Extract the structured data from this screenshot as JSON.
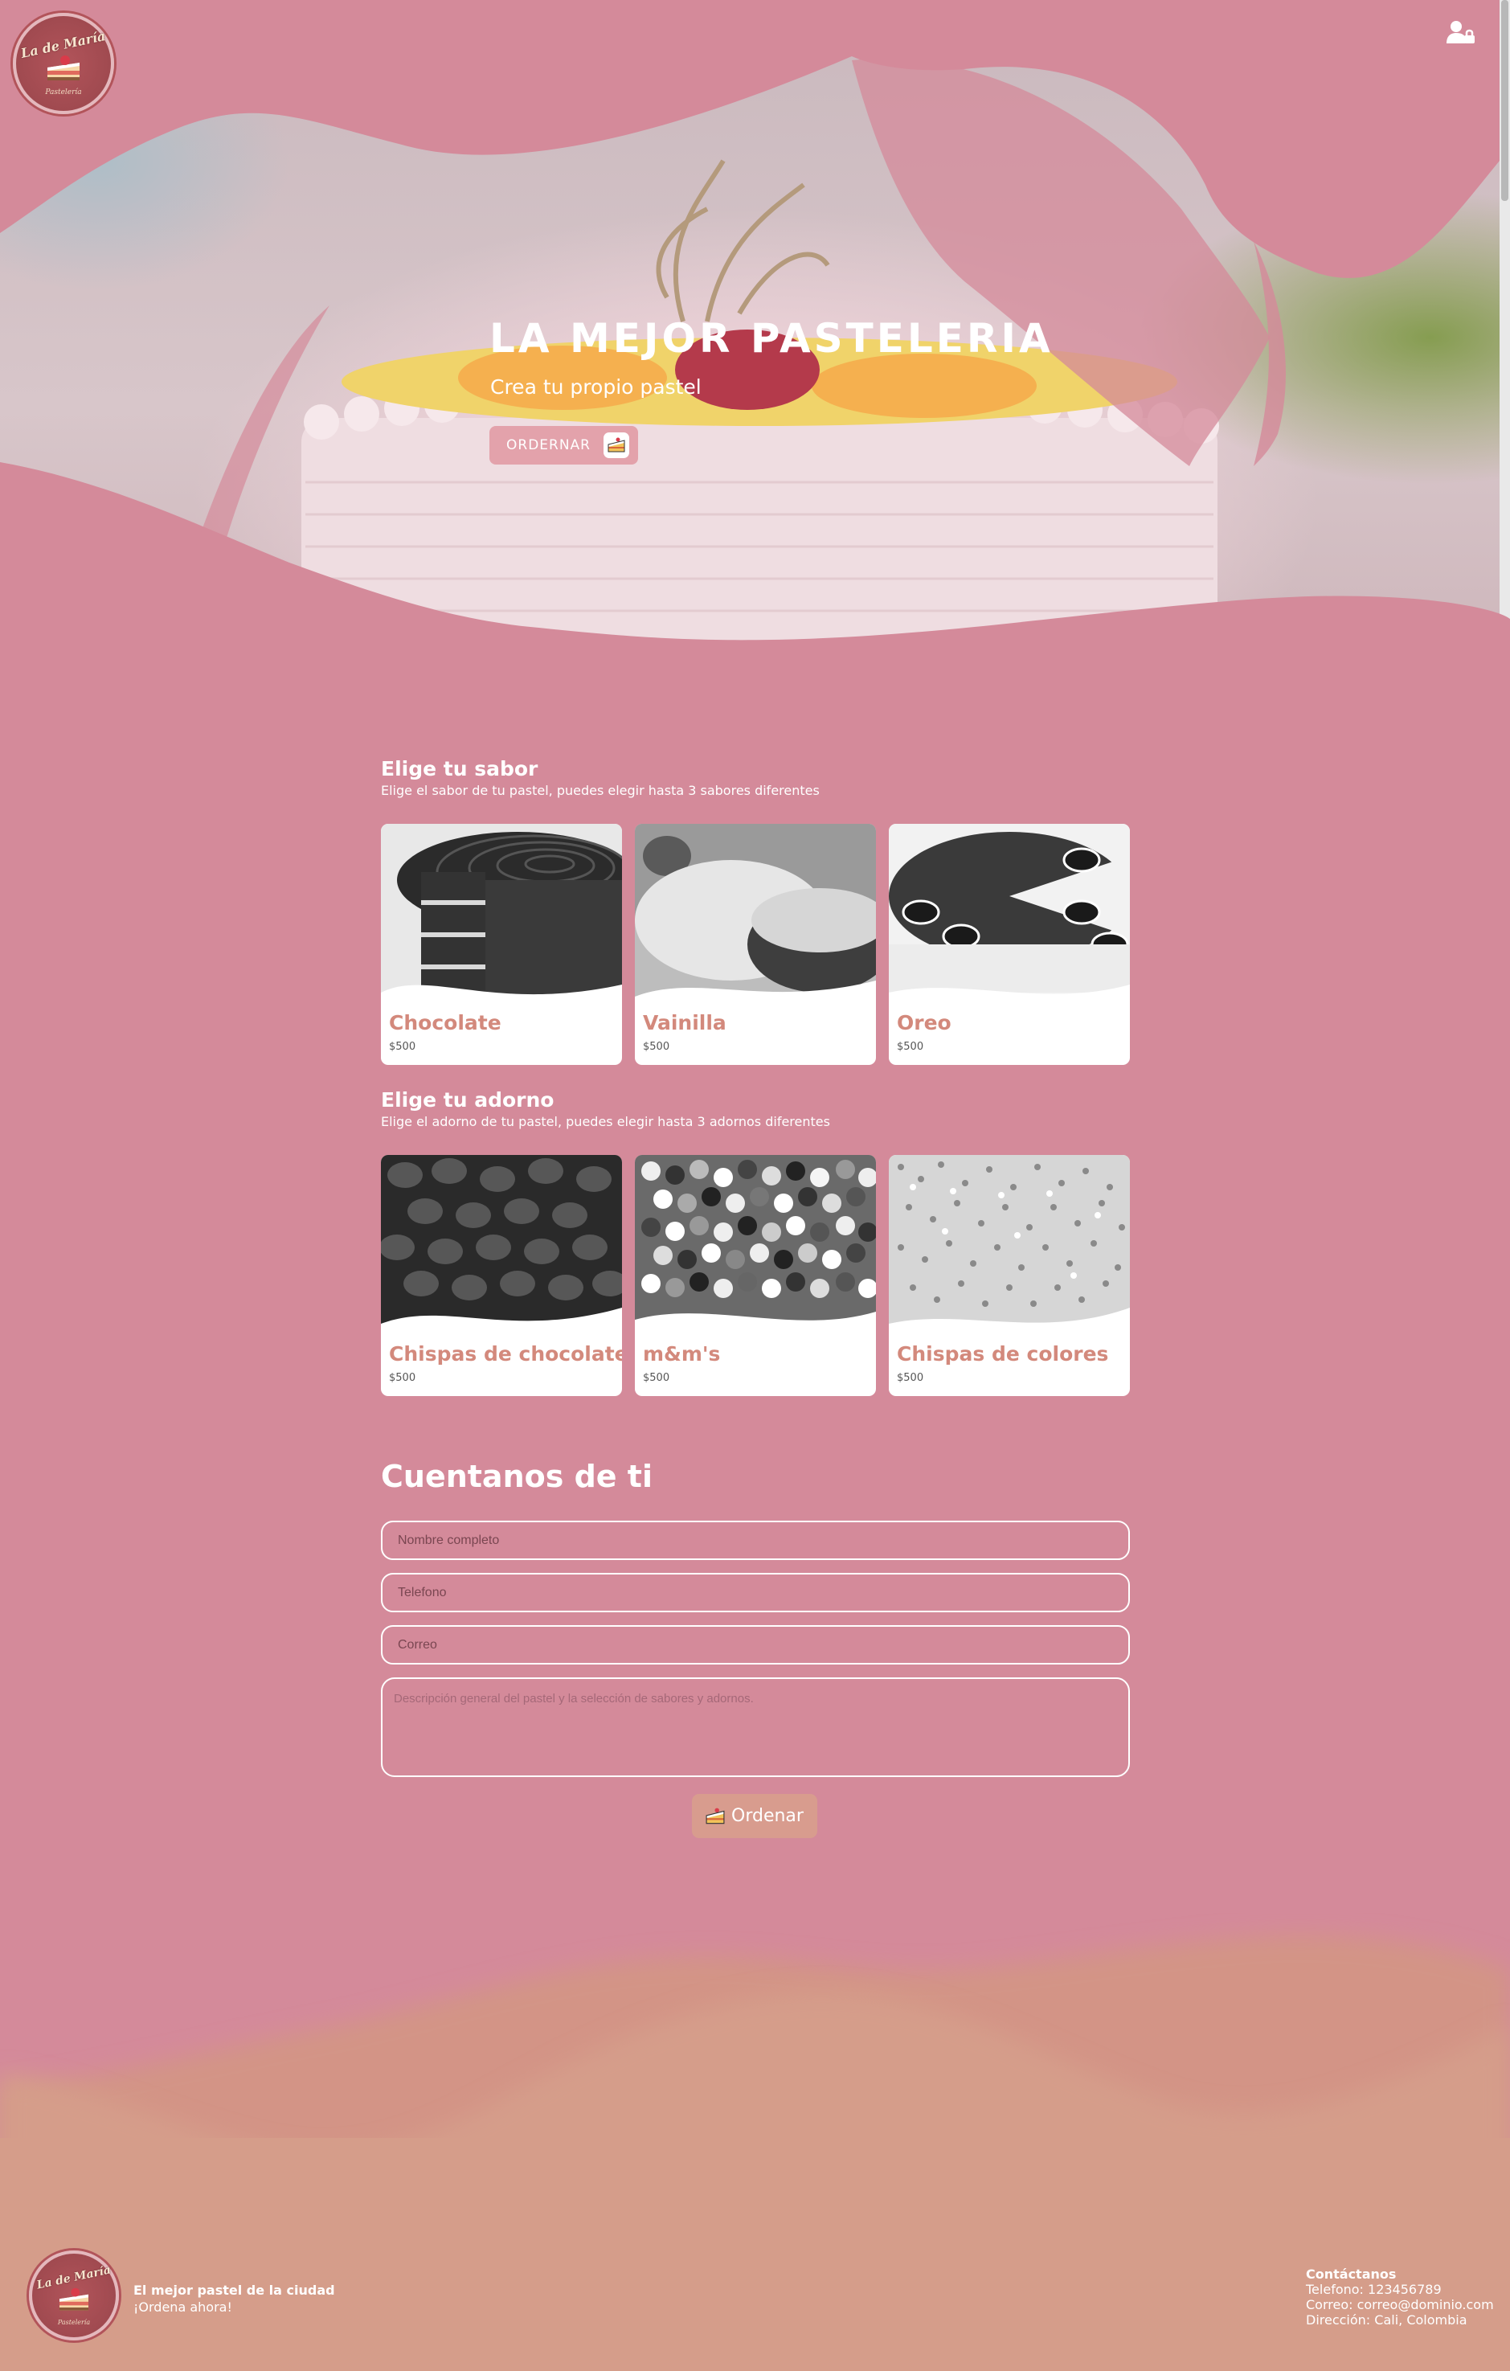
{
  "brand": {
    "logo_script": "La de María",
    "logo_sub": "Pastelería"
  },
  "hero": {
    "title": "LA MEJOR PASTELERIA",
    "subtitle": "Crea tu propio pastel",
    "order_button": "ORDERNAR"
  },
  "flavors": {
    "title": "Elige tu sabor",
    "description": "Elige el sabor de tu pastel, puedes elegir hasta 3 sabores diferentes",
    "items": [
      {
        "name": "Chocolate",
        "price": "$500"
      },
      {
        "name": "Vainilla",
        "price": "$500"
      },
      {
        "name": "Oreo",
        "price": "$500"
      }
    ]
  },
  "toppings": {
    "title": "Elige tu adorno",
    "description": "Elige el adorno de tu pastel, puedes elegir hasta 3 adornos diferentes",
    "items": [
      {
        "name": "Chispas de chocolate",
        "price": "$500"
      },
      {
        "name": "m&m's",
        "price": "$500"
      },
      {
        "name": "Chispas de colores",
        "price": "$500"
      }
    ]
  },
  "form": {
    "title": "Cuentanos de ti",
    "name_placeholder": "Nombre completo",
    "phone_placeholder": "Telefono",
    "email_placeholder": "Correo",
    "description_placeholder": "Descripción general del pastel y la selección de sabores y adornos.",
    "submit_label": "Ordenar"
  },
  "footer": {
    "tagline": "El mejor pastel de la ciudad",
    "cta": "¡Ordena ahora!",
    "contact": {
      "heading": "Contáctanos",
      "phone": "Telefono: 123456789",
      "email": "Correo: correo@dominio.com",
      "address": "Dirección: Cali, Colombia"
    }
  },
  "colors": {
    "background": "#d48a9a",
    "card_title": "#d3897c",
    "footer": "#d59d8a",
    "button": "#e3a2ab"
  },
  "icons": [
    "user-lock-icon",
    "cake-icon"
  ]
}
